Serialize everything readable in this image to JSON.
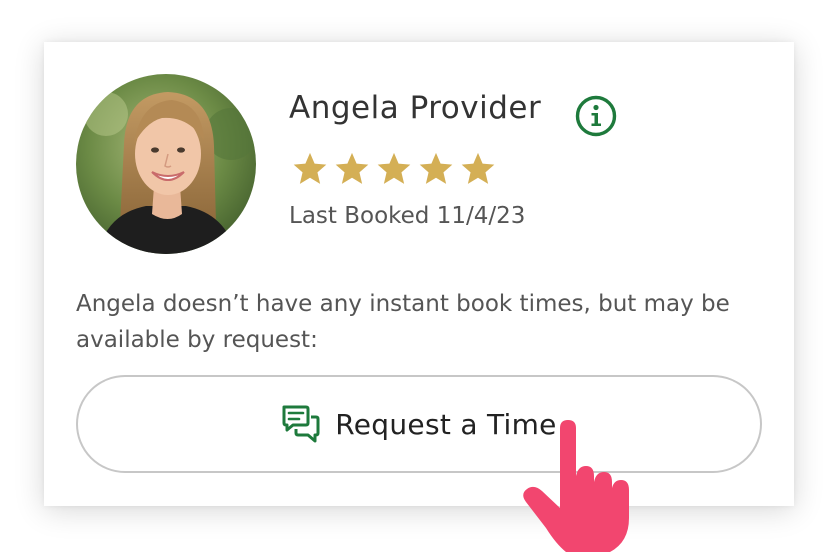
{
  "provider": {
    "name": "Angela Provider",
    "rating": 5,
    "rating_max": 5,
    "last_booked": "Last Booked 11/4/23",
    "avatar_description": "provider-portrait"
  },
  "availability": {
    "message": "Angela doesn’t have any instant book times, but may be available by request:"
  },
  "request_button": {
    "label": "Request a Time",
    "icon": "chat-bubbles-icon"
  },
  "icons": {
    "info": "info-icon",
    "star": "star-icon",
    "cursor": "hand-pointer-icon"
  },
  "colors": {
    "accent_green": "#1e7a3c",
    "star_gold": "#d4af55",
    "cursor_pink": "#f2466f",
    "text_dark": "#333333",
    "text_muted": "#555555",
    "button_border": "#c7c7c7"
  }
}
